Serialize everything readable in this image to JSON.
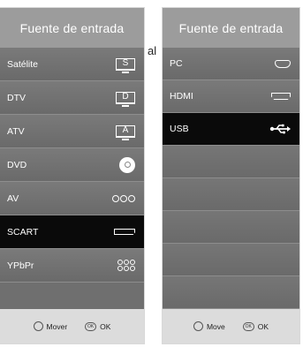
{
  "left_panel": {
    "title": "Fuente de entrada",
    "items": [
      {
        "label": "Satélite",
        "icon": "satellite-box-icon",
        "glyph": "S",
        "selected": false
      },
      {
        "label": "DTV",
        "icon": "dtv-box-icon",
        "glyph": "D",
        "selected": false
      },
      {
        "label": "ATV",
        "icon": "atv-box-icon",
        "glyph": "A",
        "selected": false
      },
      {
        "label": "DVD",
        "icon": "disc-icon",
        "selected": false
      },
      {
        "label": "AV",
        "icon": "rca-icon",
        "selected": false
      },
      {
        "label": "SCART",
        "icon": "scart-icon",
        "selected": true
      },
      {
        "label": "YPbPr",
        "icon": "component-icon",
        "selected": false
      }
    ],
    "footer": {
      "move": "Mover",
      "ok": "OK",
      "ok_icon_text": "OK"
    }
  },
  "right_panel": {
    "title": "Fuente de entrada",
    "items": [
      {
        "label": "PC",
        "icon": "vga-icon",
        "selected": false
      },
      {
        "label": "HDMI",
        "icon": "hdmi-icon",
        "selected": false
      },
      {
        "label": "USB",
        "icon": "usb-icon",
        "selected": true
      }
    ],
    "empty_rows": 5,
    "footer": {
      "move": "Move",
      "ok": "OK",
      "ok_icon_text": "OK"
    }
  },
  "stray_text": "al",
  "colors": {
    "header": "#9c9c9c",
    "row": "#6f6f6f",
    "selected": "#0a0a0a",
    "footer": "#dcdcdc"
  }
}
